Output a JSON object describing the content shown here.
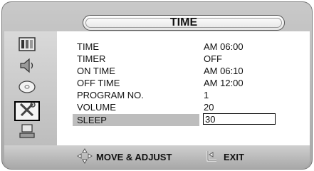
{
  "header": {
    "title": "TIME"
  },
  "sidebar": {
    "items": [
      {
        "icon": "picture-icon"
      },
      {
        "icon": "speaker-icon"
      },
      {
        "icon": "disc-icon"
      },
      {
        "icon": "tools-icon",
        "active": true
      },
      {
        "icon": "pc-icon"
      }
    ]
  },
  "menu": {
    "rows": [
      {
        "label": "TIME",
        "value": "AM 06:00"
      },
      {
        "label": "TIMER",
        "value": "OFF"
      },
      {
        "label": "ON TIME",
        "value": "AM 06:10"
      },
      {
        "label": "OFF TIME",
        "value": "AM 12:00"
      },
      {
        "label": "PROGRAM NO.",
        "value": "1"
      },
      {
        "label": "VOLUME",
        "value": "20"
      },
      {
        "label": "SLEEP",
        "value": "30",
        "selected": true
      }
    ]
  },
  "footer": {
    "move_label": "MOVE & ADJUST",
    "exit_label": "EXIT"
  }
}
